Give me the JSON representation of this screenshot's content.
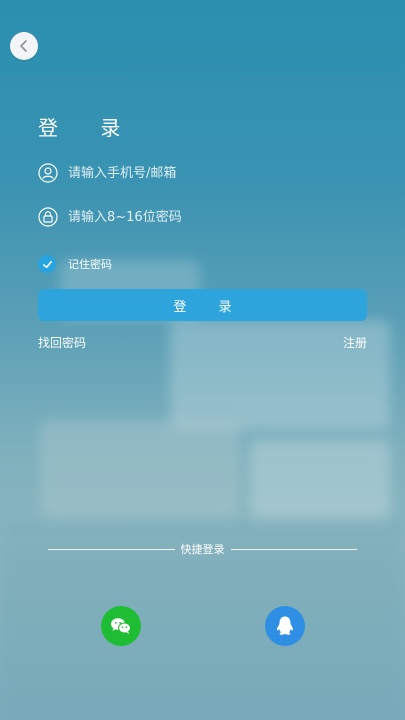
{
  "header": {
    "title": "登 录"
  },
  "form": {
    "account_placeholder": "请输入手机号/邮箱",
    "password_placeholder": "请输入8~16位密码",
    "remember_label": "记住密码",
    "remember_checked": true,
    "login_button": "登 录"
  },
  "links": {
    "forgot": "找回密码",
    "register": "注册"
  },
  "quick_login": {
    "label": "快捷登录",
    "providers": [
      {
        "name": "wechat-icon",
        "color": "#1fbd34"
      },
      {
        "name": "qq-icon",
        "color": "#2e8fe4"
      }
    ]
  },
  "colors": {
    "accent": "#2da5dc",
    "checkbox": "#27a4e0"
  }
}
